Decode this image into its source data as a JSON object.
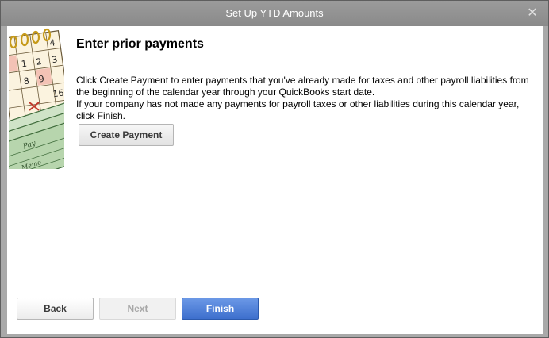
{
  "window": {
    "title": "Set Up YTD Amounts",
    "close_glyph": "✕"
  },
  "page": {
    "heading": "Enter prior payments",
    "paragraph1": "Click Create Payment to enter payments that you've already made for taxes and other payroll liabilities from the beginning of the calendar year through your QuickBooks start date.",
    "paragraph2": "If your company has not made any payments for payroll taxes or other liabilities during this calendar year, click Finish.",
    "create_payment_label": "Create Payment"
  },
  "calendar": {
    "numbers": [
      "1",
      "2",
      "3",
      "4",
      "8",
      "9",
      "16"
    ]
  },
  "check_art": {
    "text_pay": "Pay",
    "text_memo": "Memo"
  },
  "footer": {
    "back_label": "Back",
    "next_label": "Next",
    "finish_label": "Finish"
  },
  "colors": {
    "accent": "#3d6fcd",
    "titlebar": "#8a8a8a"
  },
  "icons": [
    "close-icon",
    "calendar-checks-illustration"
  ]
}
